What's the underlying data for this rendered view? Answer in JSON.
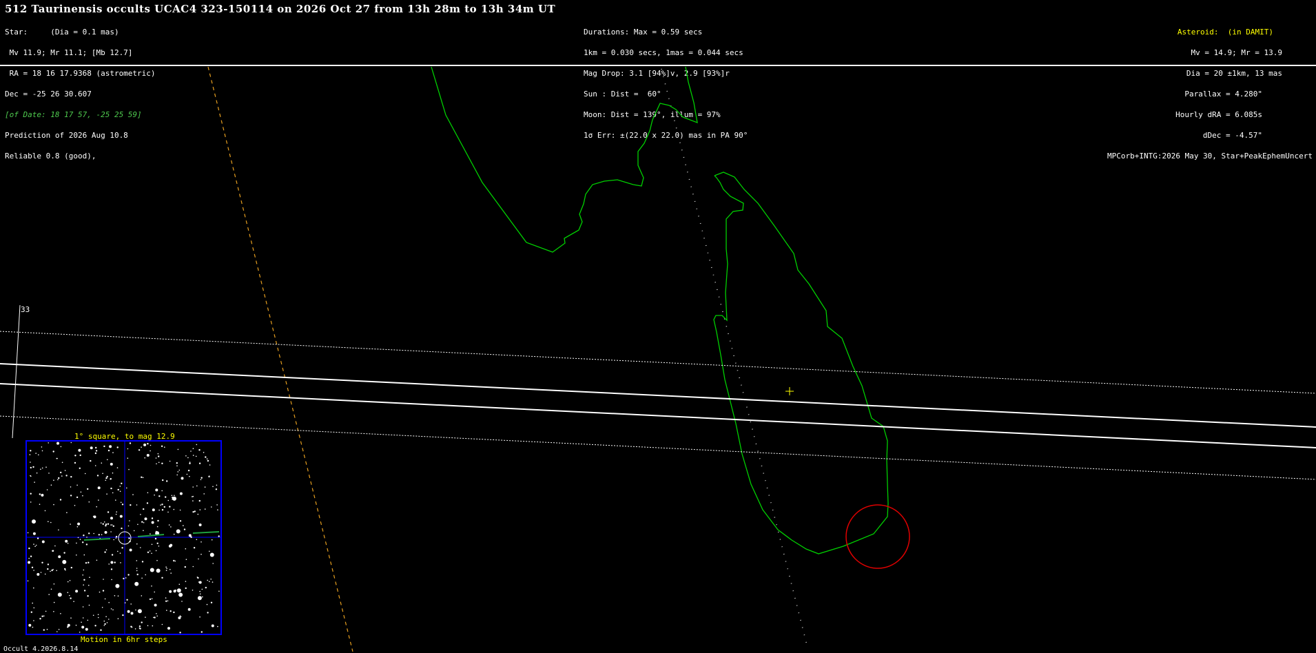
{
  "title": "512 Taurinensis occults UCAC4 323-150114 on 2026 Oct 27 from 13h 28m to 13h 34m UT",
  "star_block": {
    "lines": [
      "Star:     (Dia = 0.1 mas)",
      " Mv 11.9; Mr 11.1; [Mb 12.7]",
      " RA = 18 16 17.9368 (astrometric)",
      "Dec = -25 26 30.607",
      "[of Date: 18 17 57, -25 25 59]",
      "Prediction of 2026 Aug 10.8",
      "Reliable 0.8 (good),"
    ]
  },
  "event_block": {
    "lines": [
      "Durations: Max = 0.59 secs",
      "1km = 0.030 secs, 1mas = 0.044 secs",
      "Mag Drop: 3.1 [94%]v, 2.9 [93%]r",
      "Sun : Dist =  60°",
      "Moon: Dist = 139°, illum = 97%",
      "1σ Err: ±(22.0 x 22.0) mas in PA 90°"
    ]
  },
  "asteroid_block": {
    "header": "Asteroid:  (in DAMIT)",
    "lines": [
      "Mv = 14.9; Mr = 13.9",
      "Dia = 20 ±1km, 13 mas",
      "Parallax = 4.280\"",
      "Hourly dRA = 6.085s",
      "dDec = -4.57\"",
      "MPCorb+INTG:2026 May 30, Star+PeakEphemUncert"
    ]
  },
  "map": {
    "longitude_label": "33",
    "starchart_title": "1° square, to mag 12.9",
    "starchart_caption": "Motion in 6hr steps",
    "footer": "Occult 4.2026.8.14"
  },
  "colors": {
    "background": "#000000",
    "coastline": "#00d000",
    "path_lines": "#ffffff",
    "terminator": "#e8a020",
    "central_track": "#d0d0d0",
    "site_circle": "#e00000",
    "chart_frame": "#0000ff",
    "highlight_text": "#ffff00"
  }
}
